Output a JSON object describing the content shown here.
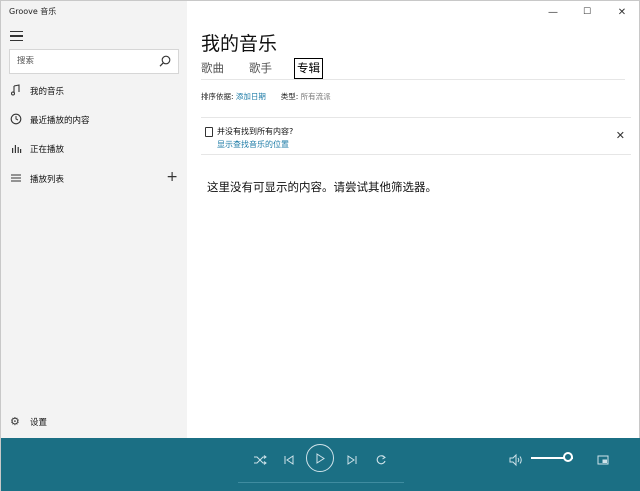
{
  "window": {
    "title": "Groove 音乐",
    "controls": {
      "minimize": "—",
      "maximize": "☐",
      "close": "✕"
    }
  },
  "sidebar": {
    "search": {
      "placeholder": "搜索"
    },
    "items": [
      {
        "label": "我的音乐",
        "icon": "music-note-icon"
      },
      {
        "label": "最近播放的内容",
        "icon": "recent-clock-icon"
      },
      {
        "label": "正在播放",
        "icon": "equalizer-icon"
      },
      {
        "label": "播放列表",
        "icon": "playlist-icon"
      }
    ],
    "settings_label": "设置"
  },
  "main": {
    "title": "我的音乐",
    "tabs": [
      {
        "label": "歌曲",
        "active": false
      },
      {
        "label": "歌手",
        "active": false
      },
      {
        "label": "专辑",
        "active": true
      }
    ],
    "sort": {
      "label": "排序依据:",
      "value": "添加日期"
    },
    "genre": {
      "label": "类型:",
      "value": "所有流派"
    },
    "notice": {
      "text": "并没有找到所有内容?",
      "link": "显示查找音乐的位置"
    },
    "empty_message": "这里没有可显示的内容。请尝试其他筛选器。"
  },
  "player": {
    "controls": [
      "shuffle-icon",
      "previous-icon",
      "play-icon",
      "next-icon",
      "repeat-icon"
    ],
    "volume_level": 0.88,
    "accent_color": "#1b6f84"
  }
}
